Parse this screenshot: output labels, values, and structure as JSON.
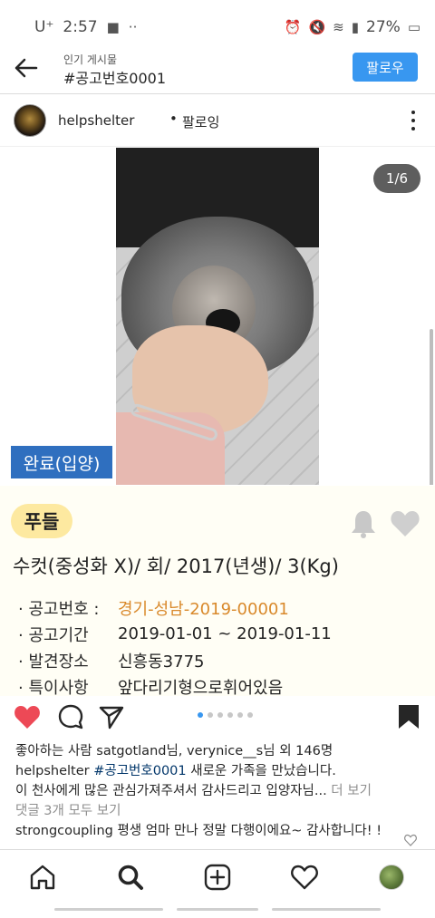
{
  "status_bar": {
    "carrier": "U⁺",
    "time": "2:57",
    "battery": "27%"
  },
  "top_bar": {
    "subtitle": "인기 게시물",
    "title": "#공고번호0001",
    "follow_label": "팔로우",
    "accent": "#3897f0"
  },
  "post_header": {
    "username": "helpshelter",
    "separator": "•",
    "following_label": "팔로잉"
  },
  "photo": {
    "counter": "1/6",
    "status_tag": "완료(입양)",
    "slide_current": 1,
    "slide_total": 6
  },
  "card": {
    "pet_name": "푸들",
    "pet_description": "수컷(중성화 X)/ 회/ 2017(년생)/ 3(Kg)",
    "info": [
      {
        "label": "· 공고번호 :",
        "value": "경기-성남-2019-00001"
      },
      {
        "label": "· 공고기간",
        "value": "2019-01-01 ~ 2019-01-11"
      },
      {
        "label": "· 발견장소",
        "value": "신흥동3775"
      },
      {
        "label": "· 특이사항",
        "value": "앞다리기형으로휘어있음"
      }
    ]
  },
  "likes": {
    "prefix": "좋아하는 사람 ",
    "liker": "satgotland",
    "middle": "님, ",
    "liker2": "verynice__s",
    "suffix": "님 외 146명"
  },
  "caption": {
    "username": "helpshelter",
    "hashtag": "#공고번호0001",
    "text": " 새로운 가족을 만났습니다.",
    "line2": "이 천사에게 많은 관심가져주셔서 감사드리고 입양자님...",
    "more": " 더 보기",
    "view_comments": "댓글 3개 모두 보기",
    "comment_user": "strongcoupling",
    "comment_text": " 평생 엄마 만나 정말 다행이에요~ 감사합니다! !"
  },
  "icons": {
    "like": "heart-filled-icon",
    "comment": "comment-icon",
    "share": "send-icon",
    "save": "bookmark-filled-icon",
    "like_color": "#ed4956"
  }
}
